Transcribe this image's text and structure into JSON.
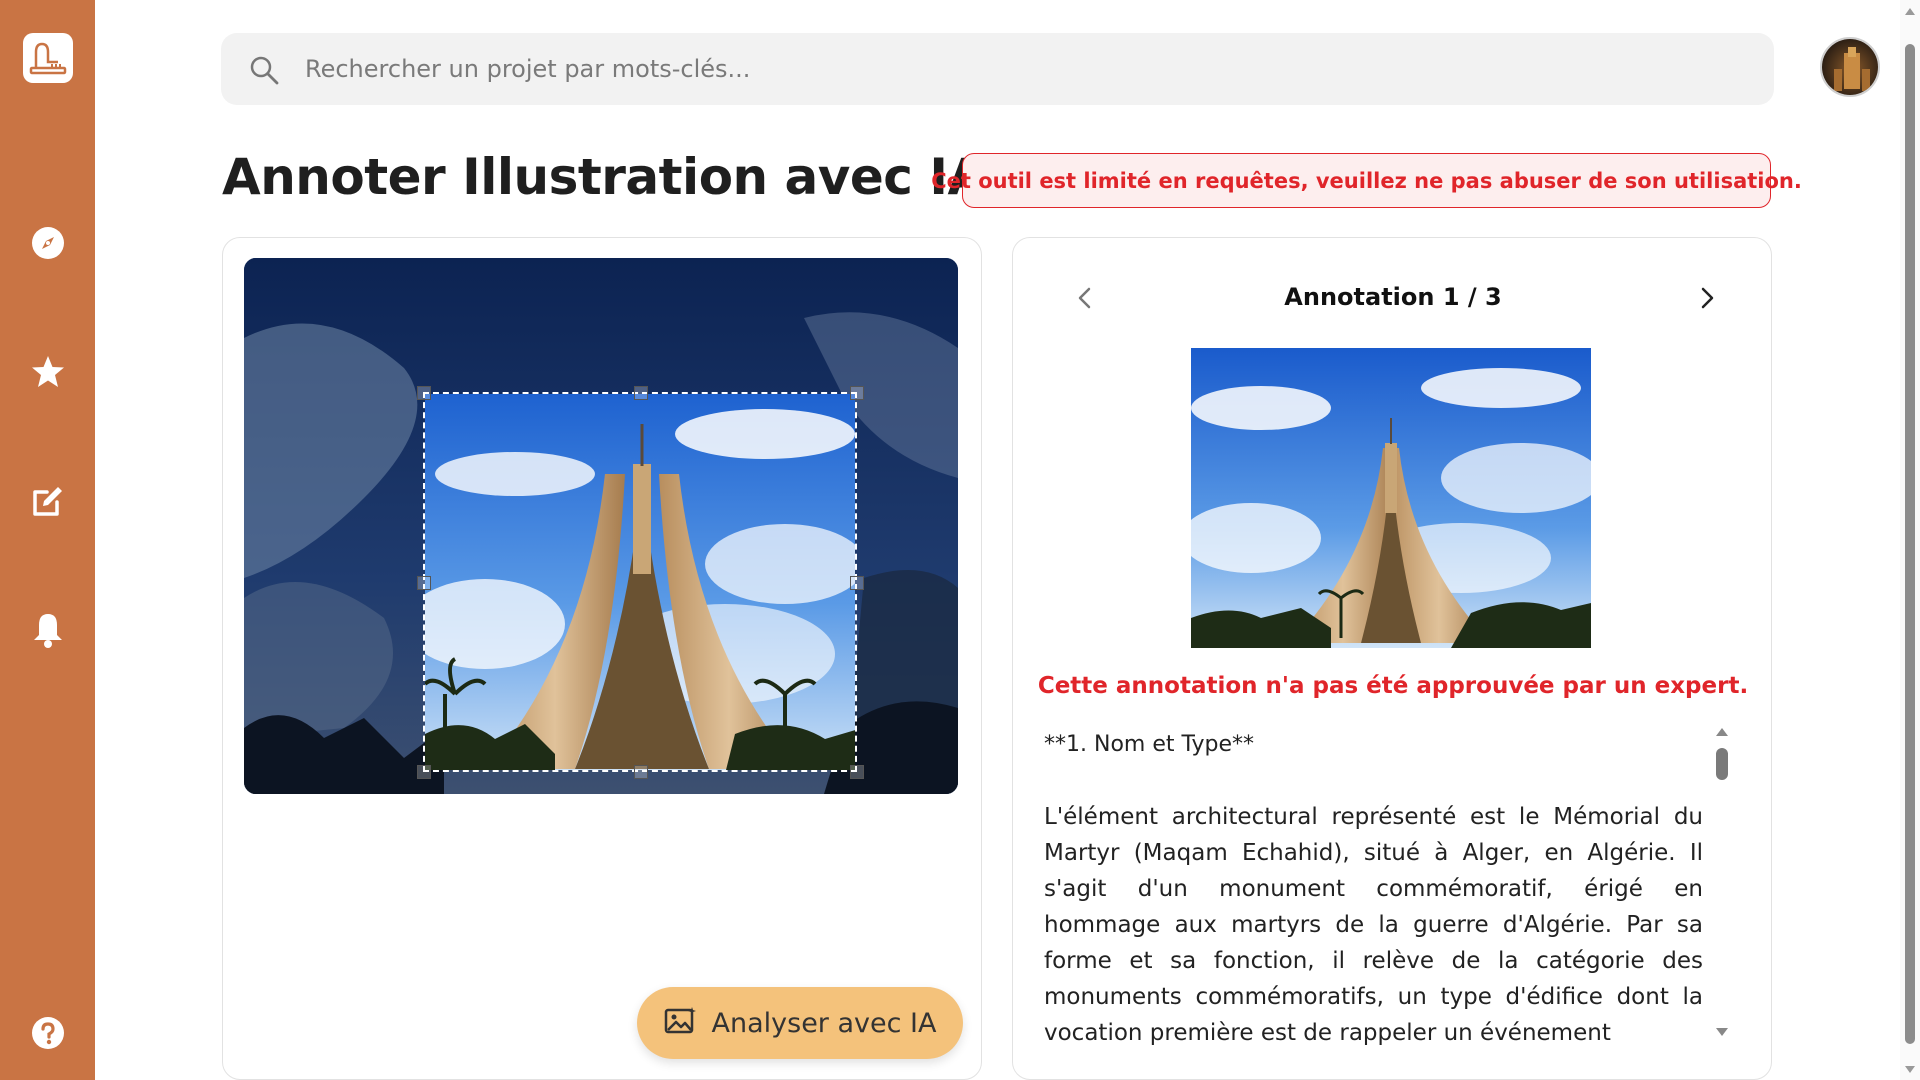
{
  "sidebar": {
    "logo_icon": "app-logo-icon",
    "items": [
      {
        "name": "explore",
        "icon": "compass-icon"
      },
      {
        "name": "favorites",
        "icon": "star-icon"
      },
      {
        "name": "annotate",
        "icon": "edit-icon"
      },
      {
        "name": "notifications",
        "icon": "bell-icon"
      }
    ],
    "help_icon": "help-icon",
    "color": "#c97444"
  },
  "search": {
    "placeholder": "Rechercher un projet par mots-clés...",
    "value": ""
  },
  "header": {
    "title": "Annoter Illustration avec IA",
    "warning": "Cet outil est limité en requêtes, veuillez ne pas abuser de son utilisation."
  },
  "editor": {
    "analyze_label": "Analyser avec IA",
    "analyze_color": "#f4c27b"
  },
  "annotation": {
    "counter": "Annotation 1 / 3",
    "status": "Cette annotation n'a pas été approuvée par un expert.",
    "heading": "**1. Nom et Type**",
    "body": "L'élément architectural représenté est le Mémorial du Martyr (Maqam Echahid), situé à Alger, en Algérie. Il s'agit d'un monument commémoratif, érigé en hommage aux martyrs de la guerre d'Algérie. Par sa forme et sa fonction, il relève de la catégorie des monuments commémoratifs, un type d'édifice dont la vocation première est de rappeler un événement"
  },
  "colors": {
    "warning_red": "#e0252a",
    "warning_bg": "#fdeeee"
  }
}
